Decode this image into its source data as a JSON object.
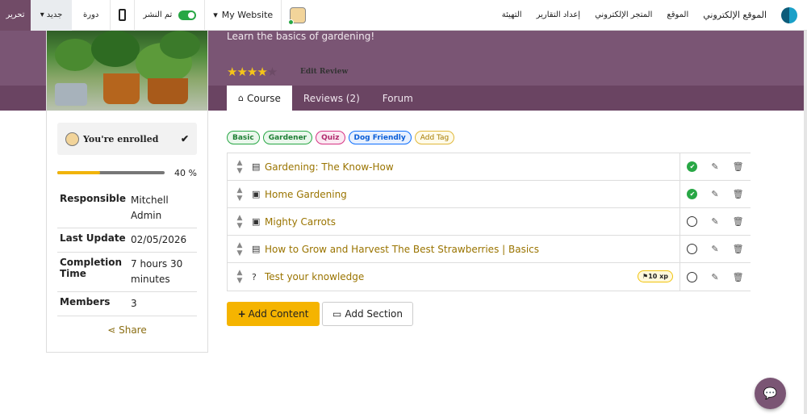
{
  "topbar": {
    "edit_label": "تحرير",
    "new_label": "جديد",
    "session_label": "دورة",
    "published_label": "تم النشر",
    "website_label": "My Website",
    "menu": [
      "التهيئة",
      "إعداد التقارير",
      "المتجر الإلكتروني",
      "الموقع",
      "الموقع الإلكتروني"
    ]
  },
  "hero": {
    "description": "Learn the basics of gardening!",
    "stars_filled": "★★★★",
    "stars_empty": "★",
    "edit_review": "Edit Review",
    "tabs": [
      {
        "label": "Course",
        "icon": "home-icon"
      },
      {
        "label": "Reviews (2)"
      },
      {
        "label": "Forum"
      }
    ]
  },
  "sidebar": {
    "enrolled": "You're enrolled",
    "progress_label": "40 %",
    "progress_value": 0.4,
    "info": [
      {
        "k": "Responsible",
        "v": "Mitchell Admin"
      },
      {
        "k": "Last Update",
        "v": "02/05/2026"
      },
      {
        "k": "Completion Time",
        "v": "7 hours 30 minutes"
      },
      {
        "k": "Members",
        "v": "3"
      }
    ],
    "share": "Share"
  },
  "tags": [
    {
      "label": "Basic",
      "color": "#28a745"
    },
    {
      "label": "Gardener",
      "color": "#28a745"
    },
    {
      "label": "Quiz",
      "color": "#d63384"
    },
    {
      "label": "Dog Friendly",
      "color": "#0d6efd"
    },
    {
      "label": "Add Tag",
      "color": "#d4a017"
    }
  ],
  "contents": [
    {
      "title": "Gardening: The Know-How",
      "type": "pdf-icon",
      "done": true
    },
    {
      "title": "Home Gardening",
      "type": "image-icon",
      "done": true
    },
    {
      "title": "Mighty Carrots",
      "type": "image-icon",
      "done": false
    },
    {
      "title": "How to Grow and Harvest The Best Strawberries | Basics",
      "type": "pdf-icon",
      "done": false
    },
    {
      "title": "Test your knowledge",
      "type": "quiz-icon",
      "done": false,
      "xp": "10 xp"
    }
  ],
  "buttons": {
    "add_content": "Add Content",
    "add_section": "Add Section"
  },
  "colors": {
    "brand": "#7a5574",
    "accent": "#f5b400",
    "link": "#9a7400"
  }
}
